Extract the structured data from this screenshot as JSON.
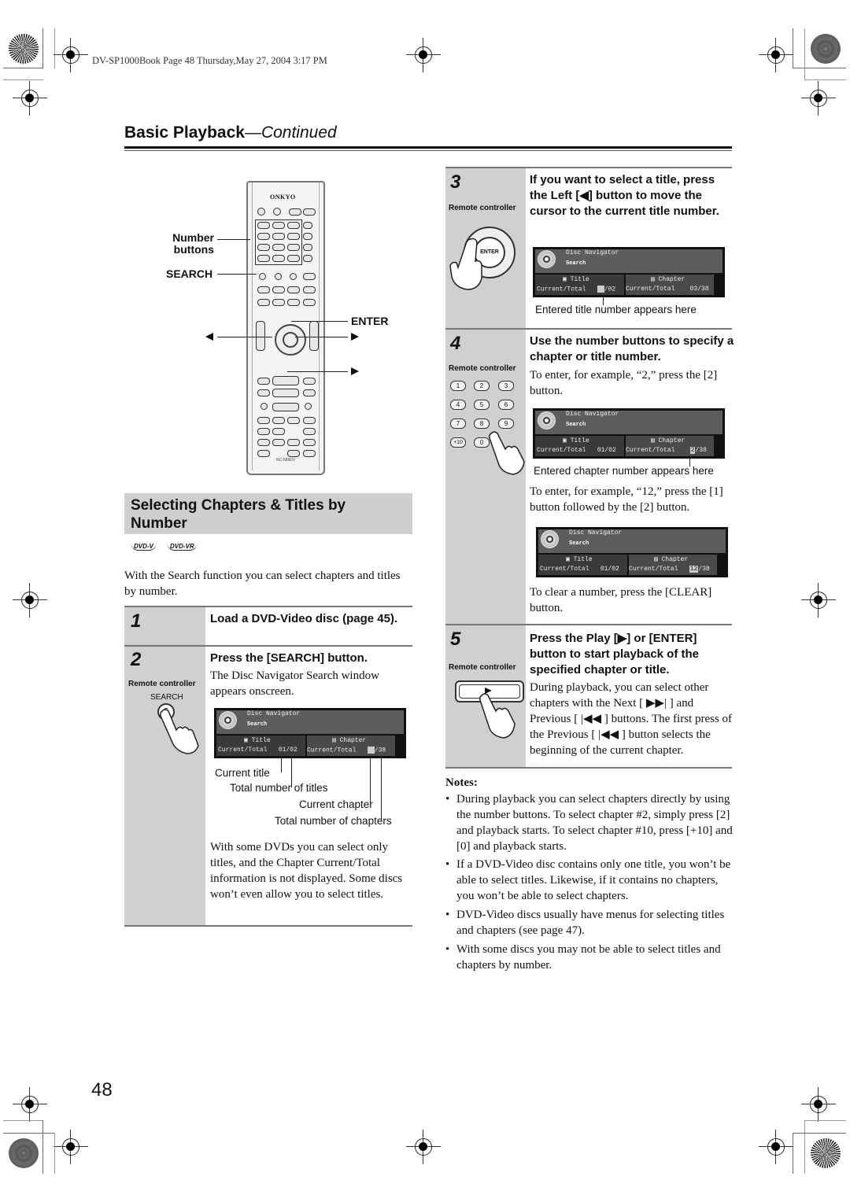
{
  "print_meta": "DV-SP1000Book  Page 48  Thursday,May 27, 2004  3:17 PM",
  "header": {
    "title_bold": "Basic Playback",
    "title_italic": "—Continued"
  },
  "remote_diagram": {
    "brand": "ONKYO",
    "model": "RC-588DV",
    "callouts": {
      "number_buttons_line1": "Number",
      "number_buttons_line2": "buttons",
      "search": "SEARCH",
      "enter": "ENTER"
    },
    "button_labels": [
      "1",
      "2",
      "3",
      "4",
      "5",
      "6",
      "7",
      "8",
      "9",
      "+10",
      "0"
    ]
  },
  "section": {
    "title": "Selecting Chapters & Titles by Number",
    "badges": [
      "DVD-V",
      "DVD-VR"
    ],
    "intro": "With the Search function you can select chapters and titles by number."
  },
  "steps": [
    {
      "number": "1",
      "heading": "Load a DVD-Video disc (page 45)."
    },
    {
      "number": "2",
      "remote_label": "Remote controller",
      "button_label": "SEARCH",
      "heading": "Press the [SEARCH] button.",
      "text": "The Disc Navigator Search window appears onscreen.",
      "screen": {
        "title": "Disc Navigator",
        "subtitle": "Search",
        "title_col": "Title",
        "chapter_col": "Chapter",
        "title_label": "Current/Total",
        "title_value": "01/02",
        "chapter_label": "Current/Total",
        "chapter_value": "/38"
      },
      "callouts": [
        "Current title",
        "Total number of titles",
        "Current chapter",
        "Total number of chapters"
      ],
      "after_text": "With some DVDs you can select only titles, and the Chapter Current/Total information is not displayed. Some discs won’t even allow you to select titles."
    },
    {
      "number": "3",
      "remote_label": "Remote controller",
      "button_label": "ENTER",
      "heading": "If you want to select a title, press the Left [◀] button to move the cursor to the current title number.",
      "screen": {
        "title": "Disc Navigator",
        "subtitle": "Search",
        "title_col": "Title",
        "chapter_col": "Chapter",
        "title_label": "Current/Total",
        "title_value": "/02",
        "chapter_label": "Current/Total",
        "chapter_value": "03/38"
      },
      "caption": "Entered title number appears here"
    },
    {
      "number": "4",
      "remote_label": "Remote controller",
      "heading": "Use the number buttons to specify a chapter or title number.",
      "text": "To enter, for example, “2,” press the [2] button.",
      "screen": {
        "title": "Disc Navigator",
        "subtitle": "Search",
        "title_col": "Title",
        "chapter_col": "Chapter",
        "title_label": "Current/Total",
        "title_value": "01/02",
        "chapter_label": "Current/Total",
        "chapter_cursor": "2",
        "chapter_value": "/38"
      },
      "caption": "Entered chapter number appears here",
      "text2": "To enter, for example, “12,” press the [1] button followed by the [2] button.",
      "screen2": {
        "title": "Disc Navigator",
        "subtitle": "Search",
        "title_col": "Title",
        "chapter_col": "Chapter",
        "title_label": "Current/Total",
        "title_value": "01/02",
        "chapter_label": "Current/Total",
        "chapter_cursor": "12",
        "chapter_value": "/38"
      },
      "text3": "To clear a number, press the [CLEAR] button."
    },
    {
      "number": "5",
      "remote_label": "Remote controller",
      "heading": "Press the Play [▶] or [ENTER] button to start playback of the specified chapter or title.",
      "text": "During playback, you can select other chapters with the Next [ ▶▶| ] and Previous [ |◀◀ ] buttons. The first press of the Previous [ |◀◀ ] button selects the beginning of the current chapter."
    }
  ],
  "notes": {
    "heading": "Notes:",
    "items": [
      "During playback you can select chapters directly by using the number buttons. To select chapter #2, simply press [2] and playback starts. To select chapter #10, press [+10] and [0] and playback starts.",
      "If a DVD-Video disc contains only one title, you won’t be able to select titles. Likewise, if it contains no chapters, you won’t be able to select chapters.",
      "DVD-Video discs usually have menus for selecting titles and chapters (see page 47).",
      "With some discs you may not be able to select titles and chapters by number."
    ]
  },
  "page_number": "48"
}
